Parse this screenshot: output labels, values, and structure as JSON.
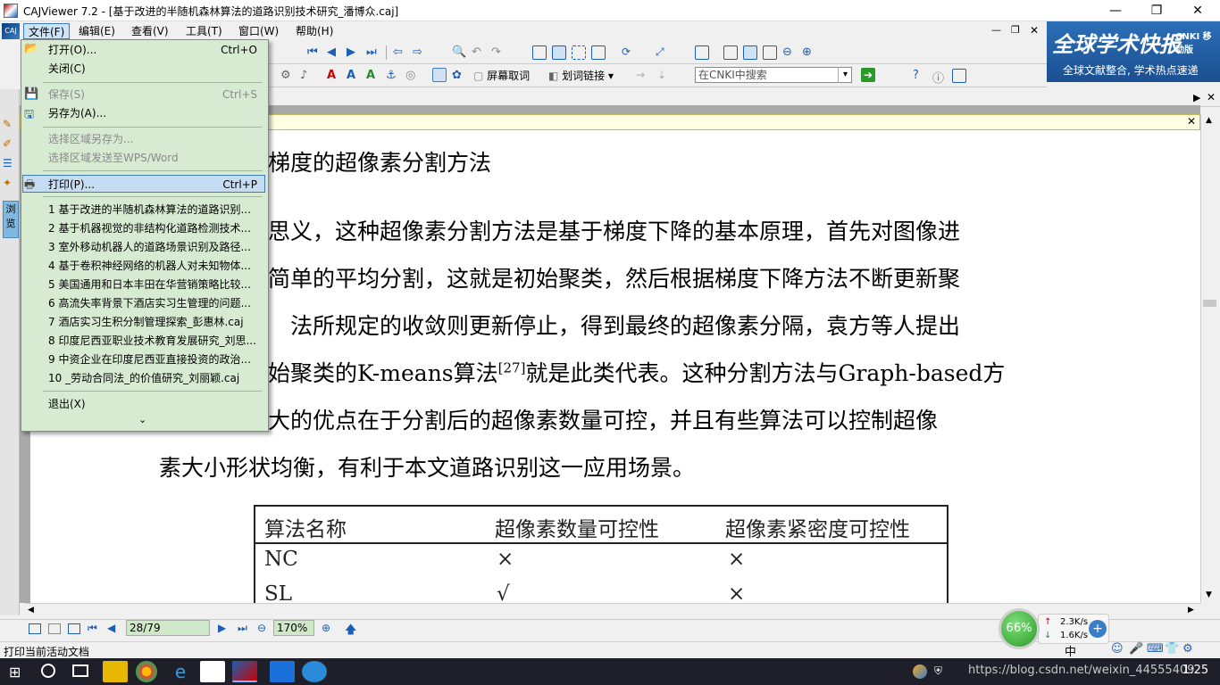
{
  "window": {
    "title": "CAJViewer 7.2 - [基于改进的半随机森林算法的道路识别技术研究_潘博众.caj]",
    "minimize": "—",
    "restore": "❐",
    "close": "✕"
  },
  "menubar": {
    "items": [
      "文件(F)",
      "编辑(E)",
      "查看(V)",
      "工具(T)",
      "窗口(W)",
      "帮助(H)"
    ],
    "mdi_min": "—",
    "mdi_restore": "❐",
    "mdi_close": "✕"
  },
  "toolbar": {
    "screen_lookup": "屏幕取词",
    "word_link": "划词链接",
    "search_placeholder": "在CNKI中搜索"
  },
  "banner": {
    "title": "全球学术快报",
    "brand": "CNKI 移动版",
    "slogan": "全球文献整合, 学术热点速递"
  },
  "sidebar": {
    "vertical_tab": "浏览"
  },
  "file_menu": {
    "open": "打开(O)...",
    "open_shortcut": "Ctrl+O",
    "close": "关闭(C)",
    "save": "保存(S)",
    "save_shortcut": "Ctrl+S",
    "save_as": "另存为(A)...",
    "save_region": "选择区域另存为...",
    "send_region": "选择区域发送至WPS/Word",
    "print": "打印(P)...",
    "print_shortcut": "Ctrl+P",
    "recent": [
      "1 基于改进的半随机森林算法的道路识别...",
      "2 基于机器视觉的非结构化道路检测技术...",
      "3 室外移动机器人的道路场景识别及路径...",
      "4 基于卷积神经网络的机器人对未知物体...",
      "5 美国通用和日本丰田在华营销策略比较...",
      "6 高流失率背景下酒店实习生管理的问题...",
      "7 酒店实习生积分制管理探索_彭惠林.caj",
      "8 印度尼西亚职业技术教育发展研究_刘思...",
      "9 中资企业在印度尼西亚直接投资的政治...",
      "10 _劳动合同法_的价值研究_刘丽颖.caj"
    ],
    "exit": "退出(X)",
    "more": "⌄"
  },
  "document": {
    "heading": "梯度的超像素分割方法",
    "lines": [
      "思义，这种超像素分割方法是基于梯度下降的基本原理，首先对图像进",
      "简单的平均分割，这就是初始聚类，然后根据梯度下降方法不断更新聚",
      "法所规定的收敛则更新停止，得到最终的超像素分隔，袁方等人提出",
      "始聚类的K-means算法",
      "就是此类代表。这种分割方法与Graph-based方",
      "大的优点在于分割后的超像素数量可控，并且有些算法可以控制超像",
      "素大小形状均衡，有利于本文道路识别这一应用场景。"
    ],
    "citation": "[27]",
    "table": {
      "headers": [
        "算法名称",
        "超像素数量可控性",
        "超像素紧密度可控性"
      ],
      "rows": [
        [
          "NC",
          "×",
          "×"
        ],
        [
          "SL",
          "√",
          "×"
        ]
      ]
    }
  },
  "navbar": {
    "page": "28/79",
    "zoom": "170%"
  },
  "status": {
    "text": "打印当前活动文档"
  },
  "network": {
    "percent": "66%",
    "up": "2.3K/s",
    "down": "1.6K/s"
  },
  "taskbar": {
    "watermark": "https://blog.csdn.net/weixin_44555409",
    "clock": "1:25"
  }
}
